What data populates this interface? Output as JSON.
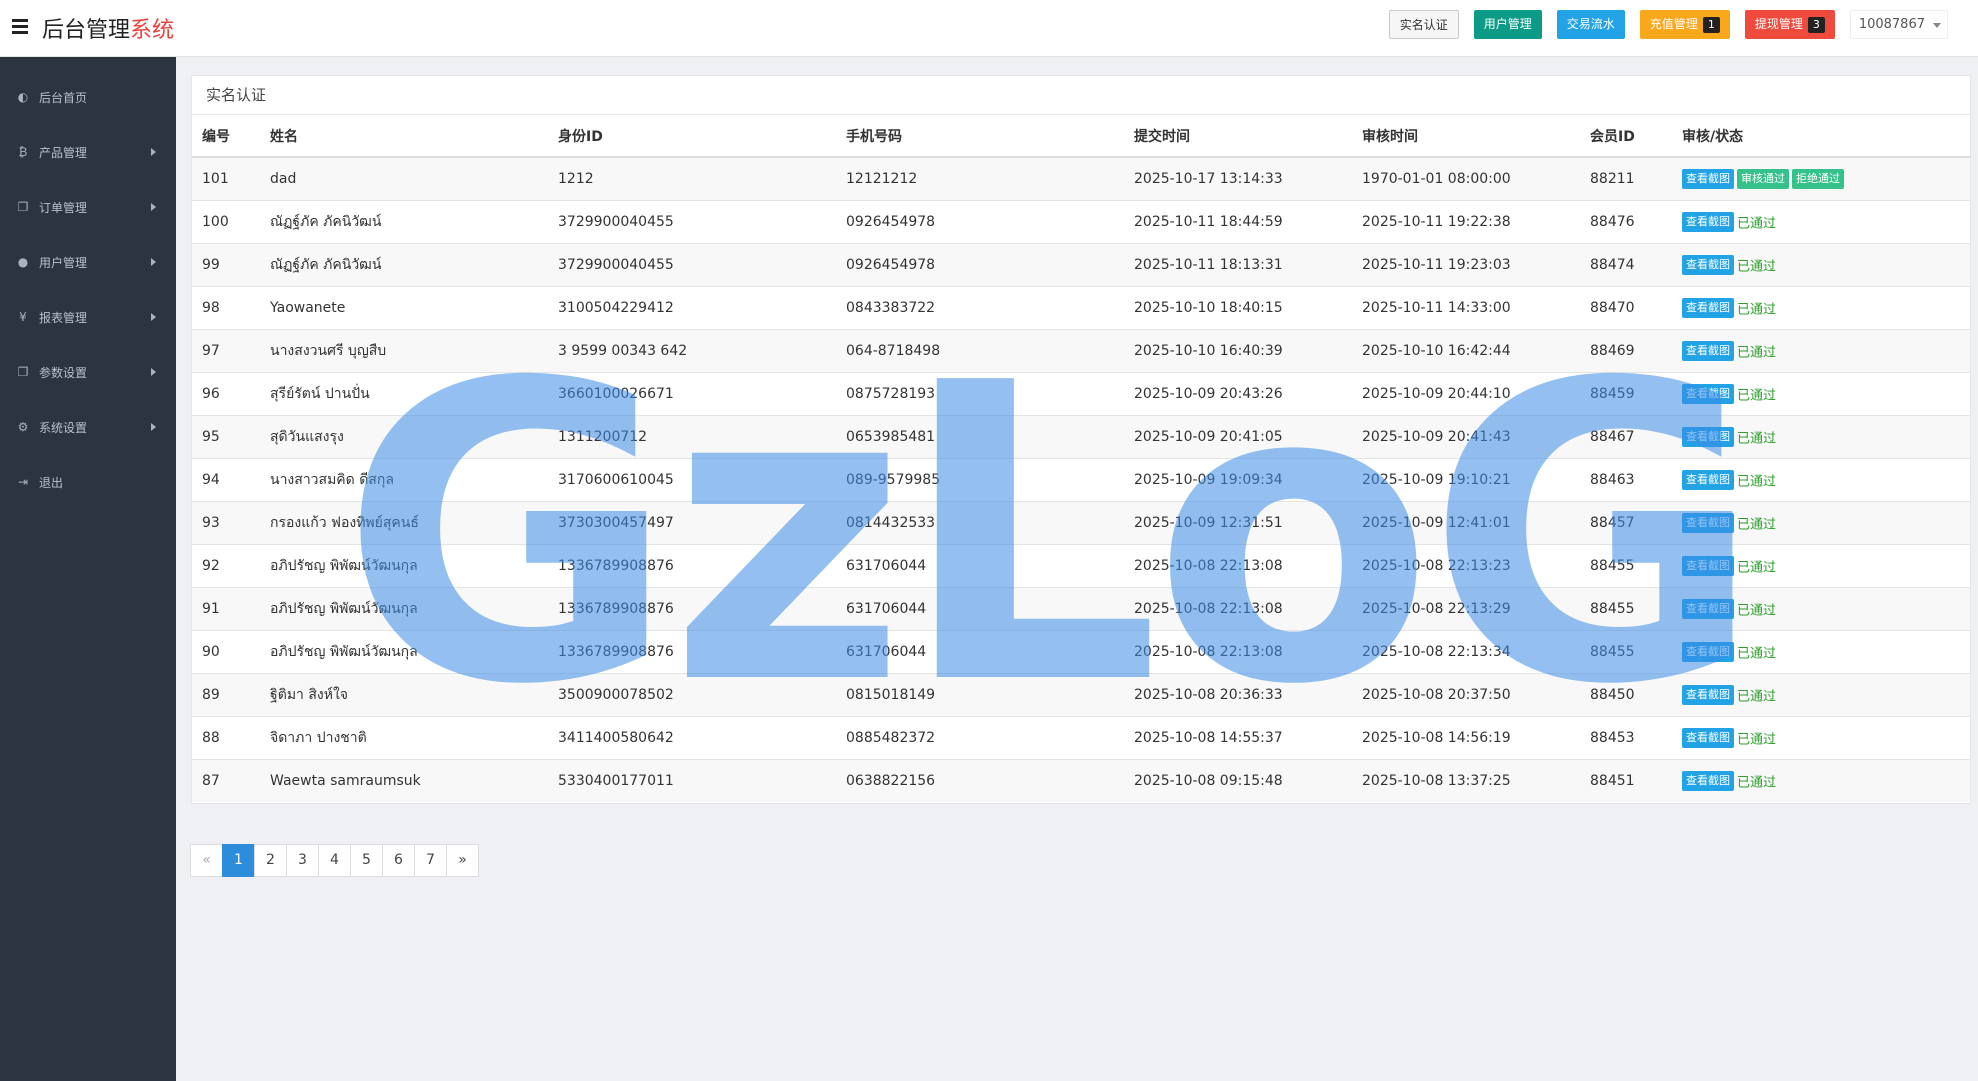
{
  "brand": {
    "main": "后台管理",
    "accent": "系统"
  },
  "topbar": {
    "buttons": [
      {
        "label": "实名认证",
        "badge": ""
      },
      {
        "label": "用户管理",
        "badge": ""
      },
      {
        "label": "交易流水",
        "badge": ""
      },
      {
        "label": "充值管理",
        "badge": "1"
      },
      {
        "label": "提现管理",
        "badge": "3"
      }
    ],
    "user": "10087867"
  },
  "sidebar": {
    "items": [
      {
        "icon": "dashboard-icon",
        "glyph": "◐",
        "label": "后台首页",
        "arrow": false
      },
      {
        "icon": "bitcoin-icon",
        "glyph": "₿",
        "label": "产品管理",
        "arrow": true
      },
      {
        "icon": "copy-icon",
        "glyph": "❐",
        "label": "订单管理",
        "arrow": true
      },
      {
        "icon": "user-icon",
        "glyph": "●",
        "label": "用户管理",
        "arrow": true
      },
      {
        "icon": "yen-icon",
        "glyph": "¥",
        "label": "报表管理",
        "arrow": true
      },
      {
        "icon": "copy-icon",
        "glyph": "❐",
        "label": "参数设置",
        "arrow": true
      },
      {
        "icon": "gears-icon",
        "glyph": "⚙",
        "label": "系统设置",
        "arrow": true
      },
      {
        "icon": "sign-out-icon",
        "glyph": "⇥",
        "label": "退出",
        "arrow": false
      }
    ]
  },
  "panel": {
    "title": "实名认证"
  },
  "table": {
    "columns": [
      "编号",
      "姓名",
      "身份ID",
      "手机号码",
      "提交时间",
      "审核时间",
      "会员ID",
      "审核/状态"
    ],
    "rows": [
      {
        "id": "101",
        "name": "dad",
        "idno": "1212",
        "phone": "12121212",
        "submit": "2025-10-17 13:14:33",
        "review": "1970-01-01 08:00:00",
        "member": "88211",
        "pending": true,
        "status": ""
      },
      {
        "id": "100",
        "name": "ณัฏฐ์ภัค ภัคนิวัฒน์",
        "idno": "3729900040455",
        "phone": "0926454978",
        "submit": "2025-10-11 18:44:59",
        "review": "2025-10-11 19:22:38",
        "member": "88476",
        "pending": false,
        "status": "已通过"
      },
      {
        "id": "99",
        "name": "ณัฏฐ์ภัค ภัคนิวัฒน์",
        "idno": "3729900040455",
        "phone": "0926454978",
        "submit": "2025-10-11 18:13:31",
        "review": "2025-10-11 19:23:03",
        "member": "88474",
        "pending": false,
        "status": "已通过"
      },
      {
        "id": "98",
        "name": "Yaowanete",
        "idno": "3100504229412",
        "phone": "0843383722",
        "submit": "2025-10-10 18:40:15",
        "review": "2025-10-11 14:33:00",
        "member": "88470",
        "pending": false,
        "status": "已通过"
      },
      {
        "id": "97",
        "name": "นางสงวนศรี บุญสืบ",
        "idno": "3 9599 00343 642",
        "phone": "064-8718498",
        "submit": "2025-10-10 16:40:39",
        "review": "2025-10-10 16:42:44",
        "member": "88469",
        "pending": false,
        "status": "已通过"
      },
      {
        "id": "96",
        "name": "สุรีย์รัตน์ ปานปั่น",
        "idno": "3660100026671",
        "phone": "0875728193",
        "submit": "2025-10-09 20:43:26",
        "review": "2025-10-09 20:44:10",
        "member": "88459",
        "pending": false,
        "status": "已通过"
      },
      {
        "id": "95",
        "name": "สุดิวันแสงรุง",
        "idno": "1311200712",
        "phone": "0653985481",
        "submit": "2025-10-09 20:41:05",
        "review": "2025-10-09 20:41:43",
        "member": "88467",
        "pending": false,
        "status": "已通过"
      },
      {
        "id": "94",
        "name": "นางสาวสมคิด ดีสกุล",
        "idno": "3170600610045",
        "phone": "089-9579985",
        "submit": "2025-10-09 19:09:34",
        "review": "2025-10-09 19:10:21",
        "member": "88463",
        "pending": false,
        "status": "已通过"
      },
      {
        "id": "93",
        "name": "กรองแก้ว ฟองทิพย์สุคนธ์",
        "idno": "3730300457497",
        "phone": "0814432533",
        "submit": "2025-10-09 12:31:51",
        "review": "2025-10-09 12:41:01",
        "member": "88457",
        "pending": false,
        "status": "已通过"
      },
      {
        "id": "92",
        "name": "อภิปรัชญ พิพัฒน์วัฒนกุล",
        "idno": "1336789908876",
        "phone": "631706044",
        "submit": "2025-10-08 22:13:08",
        "review": "2025-10-08 22:13:23",
        "member": "88455",
        "pending": false,
        "status": "已通过"
      },
      {
        "id": "91",
        "name": "อภิปรัชญ พิพัฒน์วัฒนกุล",
        "idno": "1336789908876",
        "phone": "631706044",
        "submit": "2025-10-08 22:13:08",
        "review": "2025-10-08 22:13:29",
        "member": "88455",
        "pending": false,
        "status": "已通过"
      },
      {
        "id": "90",
        "name": "อภิปรัชญ พิพัฒน์วัฒนกุล",
        "idno": "1336789908876",
        "phone": "631706044",
        "submit": "2025-10-08 22:13:08",
        "review": "2025-10-08 22:13:34",
        "member": "88455",
        "pending": false,
        "status": "已通过"
      },
      {
        "id": "89",
        "name": "ฐิติมา สิงห์ใจ",
        "idno": "3500900078502",
        "phone": "0815018149",
        "submit": "2025-10-08 20:36:33",
        "review": "2025-10-08 20:37:50",
        "member": "88450",
        "pending": false,
        "status": "已通过"
      },
      {
        "id": "88",
        "name": "จิดาภา ปางชาติ",
        "idno": "3411400580642",
        "phone": "0885482372",
        "submit": "2025-10-08 14:55:37",
        "review": "2025-10-08 14:56:19",
        "member": "88453",
        "pending": false,
        "status": "已通过"
      },
      {
        "id": "87",
        "name": "Waewta samraumsuk",
        "idno": "5330400177011",
        "phone": "0638822156",
        "submit": "2025-10-08 09:15:48",
        "review": "2025-10-08 13:37:25",
        "member": "88451",
        "pending": false,
        "status": "已通过"
      }
    ],
    "view_label": "查看截图",
    "approve_label": "审核通过",
    "reject_label": "拒绝通过"
  },
  "pagination": {
    "prev": "«",
    "pages": [
      "1",
      "2",
      "3",
      "4",
      "5",
      "6",
      "7"
    ],
    "next": "»",
    "current": "1"
  },
  "watermark": "GzLoG",
  "colors": {
    "sidebar": "#2c3440",
    "primary": "#21a3e6",
    "success": "#34c28a",
    "watermark": "#3c8ce6"
  }
}
